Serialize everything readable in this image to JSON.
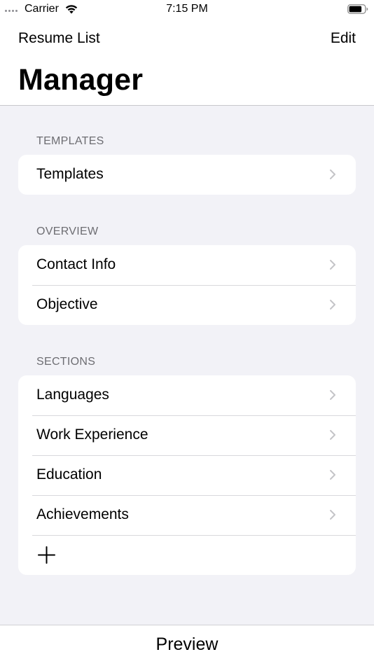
{
  "status_bar": {
    "carrier": "Carrier",
    "time": "7:15 PM",
    "wifi_icon": "wifi-icon",
    "battery_icon": "battery-icon"
  },
  "nav": {
    "back_label": "Resume List",
    "edit_label": "Edit",
    "title": "Manager"
  },
  "sections": [
    {
      "header": "TEMPLATES",
      "rows": [
        "Templates"
      ]
    },
    {
      "header": "OVERVIEW",
      "rows": [
        "Contact Info",
        "Objective"
      ]
    },
    {
      "header": "SECTIONS",
      "rows": [
        "Languages",
        "Work Experience",
        "Education",
        "Achievements"
      ],
      "add_icon": "plus-icon"
    }
  ],
  "toolbar": {
    "preview_label": "Preview"
  },
  "colors": {
    "background": "#f2f2f7",
    "card": "#ffffff",
    "section_header": "#6d6d72",
    "chevron": "#c4c4c7",
    "separator": "#d8d8dc"
  }
}
